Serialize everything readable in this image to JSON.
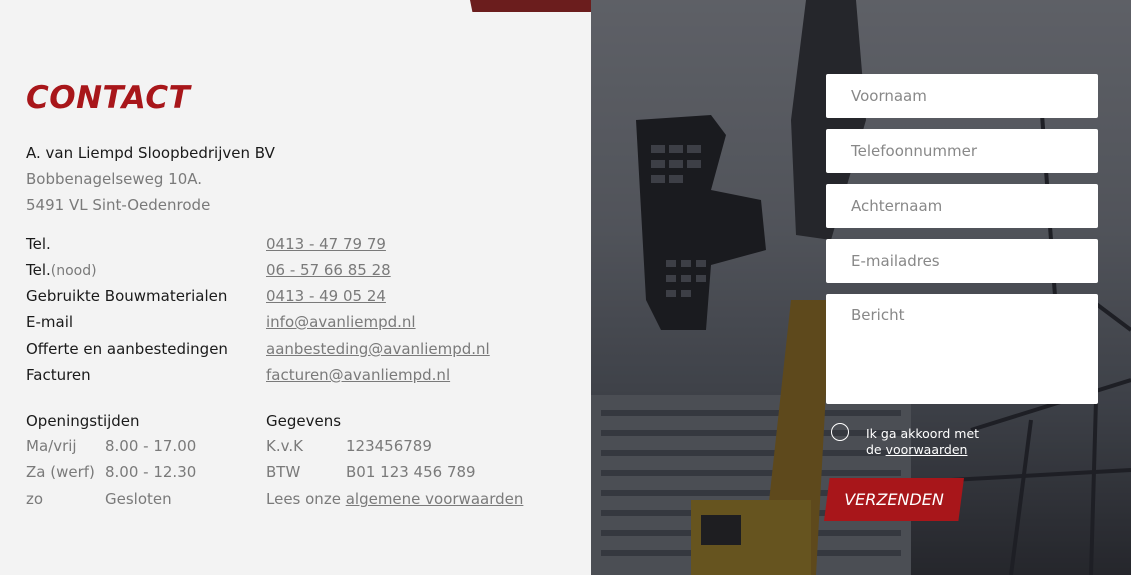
{
  "contact": {
    "title": "CONTACT",
    "company": "A. van Liempd Sloopbedrijven BV",
    "street": "Bobbenagelseweg 10A.",
    "city": "5491 VL Sint-Oedenrode",
    "rows": [
      {
        "label": "Tel.",
        "sub": "",
        "value": "0413 - 47 79 79"
      },
      {
        "label": "Tel.",
        "sub": "(nood)",
        "value": "06 - 57 66 85 28"
      },
      {
        "label": "Gebruikte Bouwmaterialen",
        "sub": "",
        "value": "0413 - 49 05 24"
      },
      {
        "label": "E-mail",
        "sub": "",
        "value": "info@avanliempd.nl"
      },
      {
        "label": "Offerte en aanbestedingen",
        "sub": "",
        "value": "aanbesteding@avanliempd.nl"
      },
      {
        "label": "Facturen",
        "sub": "",
        "value": "facturen@avanliempd.nl"
      }
    ]
  },
  "hours": {
    "title": "Openingstijden",
    "rows": [
      {
        "day": "Ma/vrij",
        "time": "8.00 - 17.00"
      },
      {
        "day": "Za (werf)",
        "time": "8.00 - 12.30"
      },
      {
        "day": "zo",
        "time": "Gesloten"
      }
    ]
  },
  "details": {
    "title": "Gegevens",
    "rows": [
      {
        "key": "K.v.K",
        "value": "123456789"
      },
      {
        "key": "BTW",
        "value": "B01 123 456 789"
      }
    ],
    "terms_prefix": "Lees onze",
    "terms_link": "algemene voorwaarden"
  },
  "form": {
    "first_name_placeholder": "Voornaam",
    "phone_placeholder": "Telefoonnummer",
    "last_name_placeholder": "Achternaam",
    "email_placeholder": "E-mailadres",
    "message_placeholder": "Bericht",
    "agree_text": "Ik ga akkoord met",
    "agree_prefix": "de",
    "agree_link": "voorwaarden",
    "submit_label": "VERZENDEN"
  },
  "colors": {
    "accent": "#a8161a",
    "background": "#f3f3f3"
  }
}
